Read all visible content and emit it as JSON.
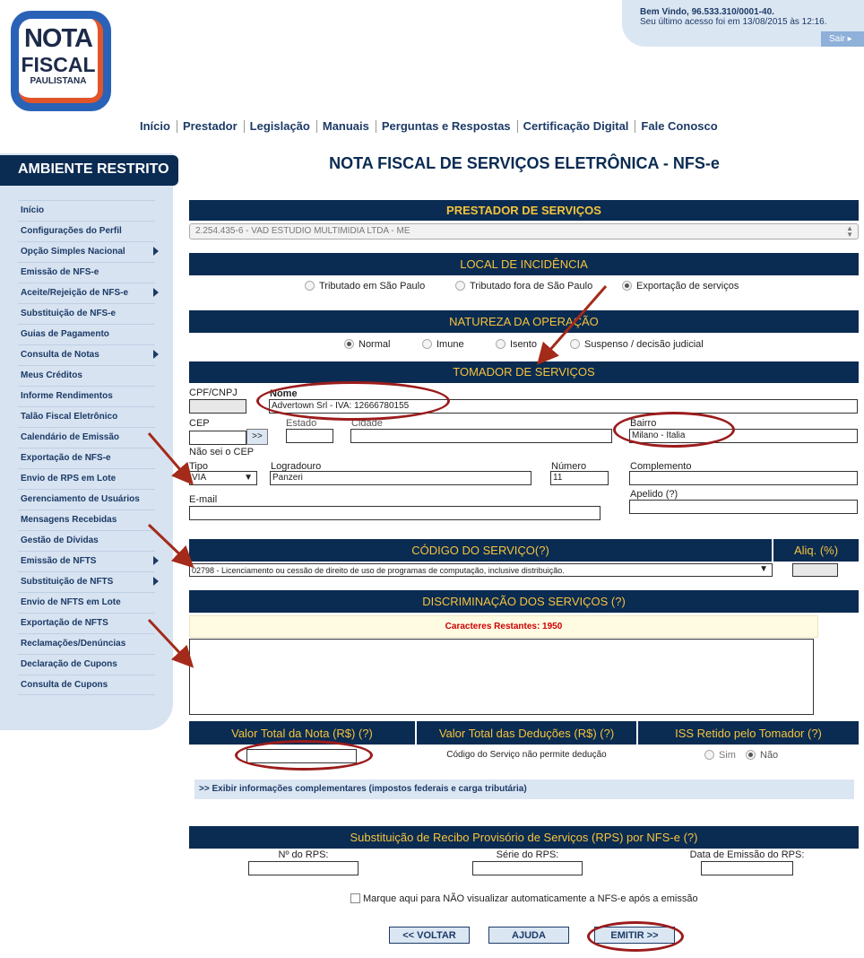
{
  "logo": {
    "line1": "NOTA",
    "line2": "FISCAL",
    "line3": "PAULISTANA"
  },
  "welcome": {
    "line1": "Bem Vindo, 96.533.310/0001-40.",
    "line2": "Seu último acesso foi em 13/08/2015 às 12:16.",
    "logout": "Sair"
  },
  "topnav": [
    "Início",
    "Prestador",
    "Legislação",
    "Manuais",
    "Perguntas e Respostas",
    "Certificação Digital",
    "Fale Conosco"
  ],
  "sidebar": {
    "title": "AMBIENTE RESTRITO",
    "items": [
      "Início",
      "Configurações do Perfil",
      "Opção Simples Nacional",
      "Emissão de NFS-e",
      "Aceite/Rejeição de NFS-e",
      "Substituição de NFS-e",
      "Guias de Pagamento",
      "Consulta de Notas",
      "Meus Créditos",
      "Informe Rendimentos",
      "Talão Fiscal Eletrônico",
      "Calendário de Emissão",
      "Exportação de NFS-e",
      "Envio de RPS em Lote",
      "Gerenciamento de Usuários",
      "Mensagens Recebidas",
      "Gestão de Dívidas",
      "Emissão de NFTS",
      "Substituição de NFTS",
      "Envio de NFTS em Lote",
      "Exportação de NFTS",
      "Reclamações/Denúncias",
      "Declaração de Cupons",
      "Consulta de Cupons"
    ]
  },
  "page_title": "NOTA FISCAL DE SERVIÇOS ELETRÔNICA - NFS-e",
  "prestador": {
    "header": "PRESTADOR DE SERVIÇOS",
    "selected": "2.254.435-6 - VAD ESTUDIO MULTIMIDIA LTDA - ME"
  },
  "local": {
    "header": "LOCAL DE INCIDÊNCIA",
    "opt1": "Tributado em São Paulo",
    "opt2": "Tributado fora de São Paulo",
    "opt3": "Exportação de serviços"
  },
  "natureza": {
    "header": "NATUREZA DA OPERAÇÃO",
    "opt1": "Normal",
    "opt2": "Imune",
    "opt3": "Isento",
    "opt4": "Suspenso / decisão judicial"
  },
  "tomador": {
    "header": "TOMADOR DE SERVIÇOS",
    "cpf_label": "CPF/CNPJ",
    "nome_label": "Nome",
    "nome_value": "Advertown Srl - IVA: 12666780155",
    "cep_label": "CEP",
    "cep_btn": ">>",
    "estado_label": "Estado",
    "cidade_label": "Cidade",
    "bairro_label": "Bairro",
    "bairro_value": "Milano - Italia",
    "naosei": "Não sei o CEP",
    "tipo_label": "Tipo",
    "tipo_value": "VIA",
    "logradouro_label": "Logradouro",
    "logradouro_value": "Panzeri",
    "numero_label": "Número",
    "numero_value": "11",
    "complemento_label": "Complemento",
    "email_label": "E-mail",
    "apelido_label": "Apelido (?)"
  },
  "codigo": {
    "header": "CÓDIGO DO SERVIÇO(?)",
    "aliq_header": "Aliq. (%)",
    "selected": "02798 - Licenciamento ou cessão de direito de uso de programas de computação, inclusive distribuição."
  },
  "discriminacao": {
    "header": "DISCRIMINAÇÃO DOS SERVIÇOS (?)",
    "remaining": "Caracteres Restantes: 1950"
  },
  "valores": {
    "total_header": "Valor Total da Nota (R$) (?)",
    "deducoes_header": "Valor Total das Deduções (R$) (?)",
    "iss_header": "ISS Retido pelo Tomador (?)",
    "deducao_note": "Código do Serviço não permite dedução",
    "sim": "Sim",
    "nao": "Não"
  },
  "complementares": ">> Exibir informações complementares (impostos federais e carga tributária)",
  "rps": {
    "header": "Substituição de Recibo Provisório de Serviços (RPS) por NFS-e (?)",
    "numero": "Nº do RPS:",
    "serie": "Série do RPS:",
    "data": "Data de Emissão do RPS:"
  },
  "checkbox_label": "Marque aqui para NÃO visualizar automaticamente a NFS-e após a emissão",
  "buttons": {
    "voltar": "<< VOLTAR",
    "ajuda": "AJUDA",
    "emitir": "EMITIR >>"
  },
  "colors": {
    "navy": "#0a2b52",
    "gold": "#f5c33b",
    "sidebar": "#d7e3f1",
    "annotation": "#9b1c1c",
    "warning": "#cc0000"
  }
}
